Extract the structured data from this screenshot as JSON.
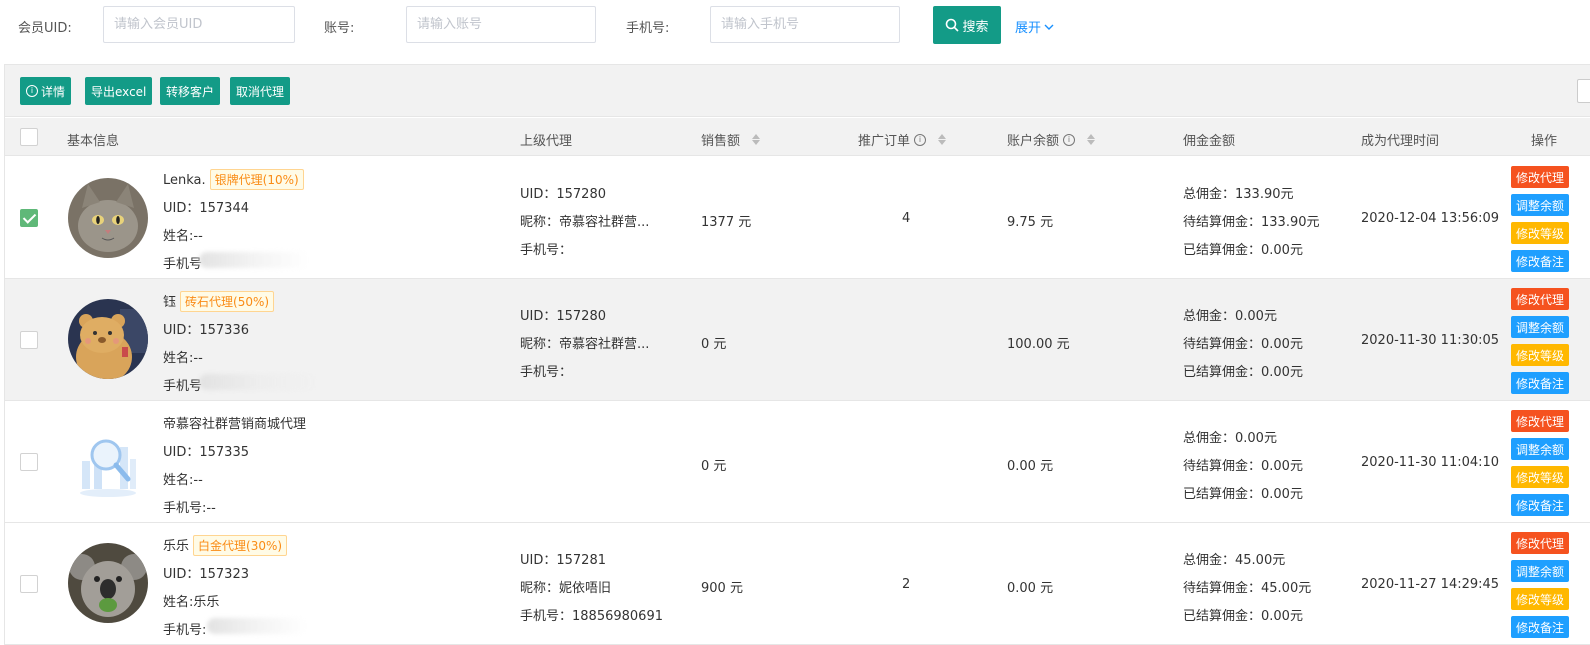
{
  "filters": {
    "uid_label": "会员UID:",
    "uid_placeholder": "请输入会员UID",
    "account_label": "账号:",
    "account_placeholder": "请输入账号",
    "phone_label": "手机号:",
    "phone_placeholder": "请输入手机号",
    "search_label": "搜索",
    "expand_label": "展开"
  },
  "toolbar": {
    "detail": "详情",
    "export": "导出excel",
    "transfer": "转移客户",
    "cancel_agent": "取消代理"
  },
  "columns": {
    "basic": "基本信息",
    "parent": "上级代理",
    "sales": "销售额",
    "orders": "推广订单",
    "balance": "账户余额",
    "commission": "佣金金额",
    "since": "成为代理时间",
    "ops": "操作"
  },
  "labels": {
    "name_prefix": "姓名:",
    "phone_prefix": "手机号",
    "uid_prefix": "UID：",
    "nick_prefix": "昵称：",
    "parent_phone_prefix": "手机号："
  },
  "ops": {
    "edit_agent": "修改代理",
    "adjust_balance": "调整余额",
    "edit_level": "修改等级",
    "edit_note": "修改备注"
  },
  "colors": {
    "primary_green": "#139b87",
    "op_red": "#f5521f",
    "op_blue": "#1e9fff",
    "op_gold": "#ffb800"
  },
  "rows": [
    {
      "checked": true,
      "nickname": "Lenka.",
      "badge": "银牌代理(10%)",
      "uid": "UID：157344",
      "name": "姓名:--",
      "phone": "手机号",
      "avatar": "cat-avatar",
      "parent_uid": "UID：157280",
      "parent_nick": "昵称：帝慕容社群营...",
      "parent_phone": "手机号：",
      "sales": "1377 元",
      "orders": "4",
      "balance": "9.75 元",
      "total_commission": "总佣金：133.90元",
      "pending_commission": "待结算佣金：133.90元",
      "settled_commission": "已结算佣金：0.00元",
      "since": "2020-12-04 13:56:09"
    },
    {
      "checked": false,
      "nickname": "钰",
      "badge": "砖石代理(50%)",
      "uid": "UID：157336",
      "name": "姓名:--",
      "phone": "手机号",
      "avatar": "bear-avatar",
      "parent_uid": "UID：157280",
      "parent_nick": "昵称：帝慕容社群营...",
      "parent_phone": "手机号：",
      "sales": "0 元",
      "orders": "",
      "balance": "100.00 元",
      "total_commission": "总佣金：0.00元",
      "pending_commission": "待结算佣金：0.00元",
      "settled_commission": "已结算佣金：0.00元",
      "since": "2020-11-30 11:30:05"
    },
    {
      "checked": false,
      "nickname": "帝慕容社群营销商城代理",
      "badge": "",
      "uid": "UID：157335",
      "name": "姓名:--",
      "phone": "手机号:--",
      "avatar": "empty-search-avatar",
      "parent_uid": "",
      "parent_nick": "",
      "parent_phone": "",
      "sales": "0 元",
      "orders": "",
      "balance": "0.00 元",
      "total_commission": "总佣金：0.00元",
      "pending_commission": "待结算佣金：0.00元",
      "settled_commission": "已结算佣金：0.00元",
      "since": "2020-11-30 11:04:10"
    },
    {
      "checked": false,
      "nickname": "乐乐",
      "badge": "白金代理(30%)",
      "uid": "UID：157323",
      "name": "姓名:乐乐",
      "phone": "手机号:",
      "avatar": "koala-avatar",
      "parent_uid": "UID：157281",
      "parent_nick": "昵称：妮依唔旧",
      "parent_phone": "手机号：18856980691",
      "sales": "900 元",
      "orders": "2",
      "balance": "0.00 元",
      "total_commission": "总佣金：45.00元",
      "pending_commission": "待结算佣金：45.00元",
      "settled_commission": "已结算佣金：0.00元",
      "since": "2020-11-27 14:29:45"
    }
  ]
}
